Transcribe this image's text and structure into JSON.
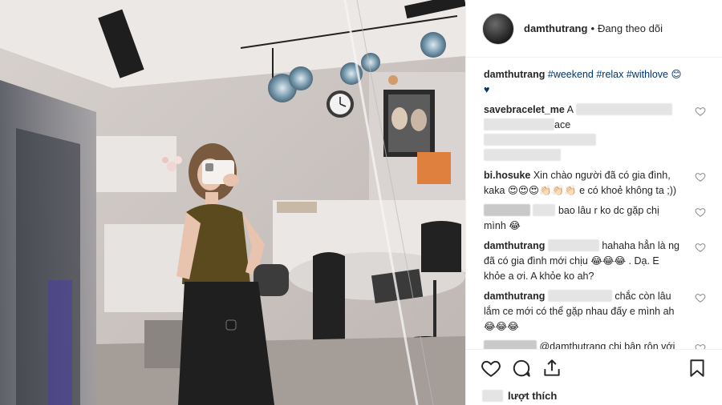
{
  "header": {
    "username": "damthutrang",
    "separator": "•",
    "follow_status": "Đang theo dõi"
  },
  "caption": {
    "user": "damthutrang",
    "text": "#weekend #relax #withlove 😊♥"
  },
  "comments": [
    {
      "user": "savebracelet_me",
      "text": "A"
    },
    {
      "user": "",
      "text": "ace"
    },
    {
      "user": "bi.hosuke",
      "text": "Xin chào người đã có gia đình, kaka 😍😍😍👏🏻👏🏻👏🏻 e có khoẻ không ta ;))"
    },
    {
      "user": "",
      "text": "bao lâu r ko dc gặp chị mình 😂"
    },
    {
      "user": "damthutrang",
      "text": "hahaha hẳn là ng đã có gia đình mới chịu 😂😂😂 . Dạ. E khỏe a ơi. A khỏe ko ah?"
    },
    {
      "user": "damthutrang",
      "text": "chắc còn lâu lắm ce mới có thể gặp nhau đấy e mình ah 😂😂😂"
    },
    {
      "user": "",
      "text": "@damthutrang chị bận rộn với yêu thương quá 😆 thui em chờ đến ngày trọng đại của chị mình 😆"
    }
  ],
  "likes": {
    "label": "lượt thích"
  },
  "icons": [
    "heart-icon",
    "comment-icon",
    "share-icon",
    "bookmark-icon"
  ],
  "colors": {
    "link": "#003569",
    "border": "#efefef",
    "text": "#262626"
  }
}
